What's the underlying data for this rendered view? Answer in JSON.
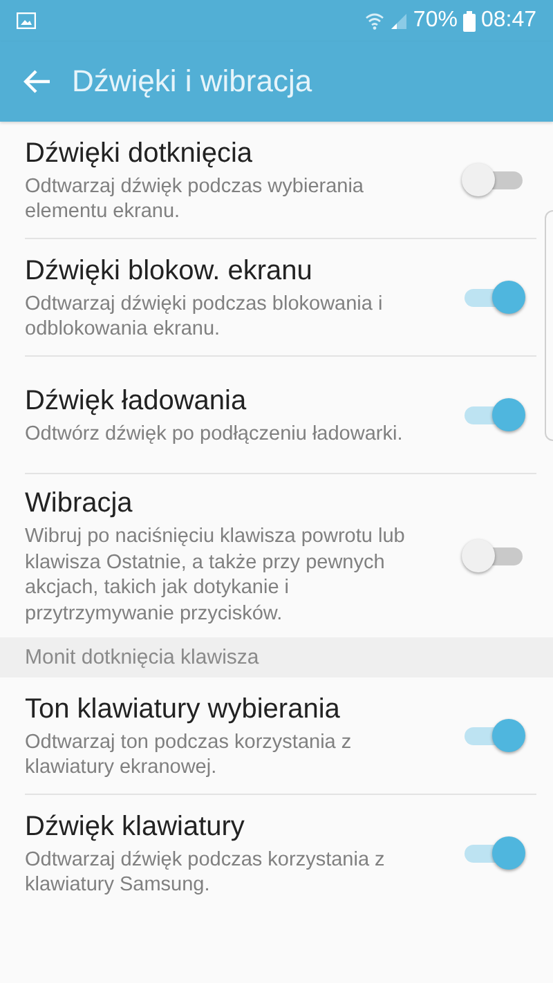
{
  "status_bar": {
    "battery": "70%",
    "time": "08:47"
  },
  "app_bar": {
    "title": "Dźwięki i wibracja"
  },
  "items": [
    {
      "kind": "toggle",
      "title": "Dźwięki dotknięcia",
      "description": "Odtwarzaj dźwięk podczas wybierania elementu ekranu.",
      "on": false
    },
    {
      "kind": "toggle",
      "title": "Dźwięki blokow. ekranu",
      "description": "Odtwarzaj dźwięki podczas blokowania i odblokowania ekranu.",
      "on": true
    },
    {
      "kind": "toggle",
      "title": "Dźwięk ładowania",
      "description": "Odtwórz dźwięk po podłączeniu ładowarki.",
      "on": true
    },
    {
      "kind": "toggle",
      "title": "Wibracja",
      "description": "Wibruj po naciśnięciu klawisza powrotu lub klawisza Ostatnie, a także przy pewnych akcjach, takich jak dotykanie i przytrzymywanie przycisków.",
      "on": false
    },
    {
      "kind": "header",
      "title": "Monit dotknięcia klawisza"
    },
    {
      "kind": "toggle",
      "title": "Ton klawiatury wybierania",
      "description": "Odtwarzaj ton podczas korzystania z klawiatury ekranowej.",
      "on": true
    },
    {
      "kind": "toggle",
      "title": "Dźwięk klawiatury",
      "description": "Odtwarzaj dźwięk podczas korzystania z klawiatury Samsung.",
      "on": true
    }
  ]
}
